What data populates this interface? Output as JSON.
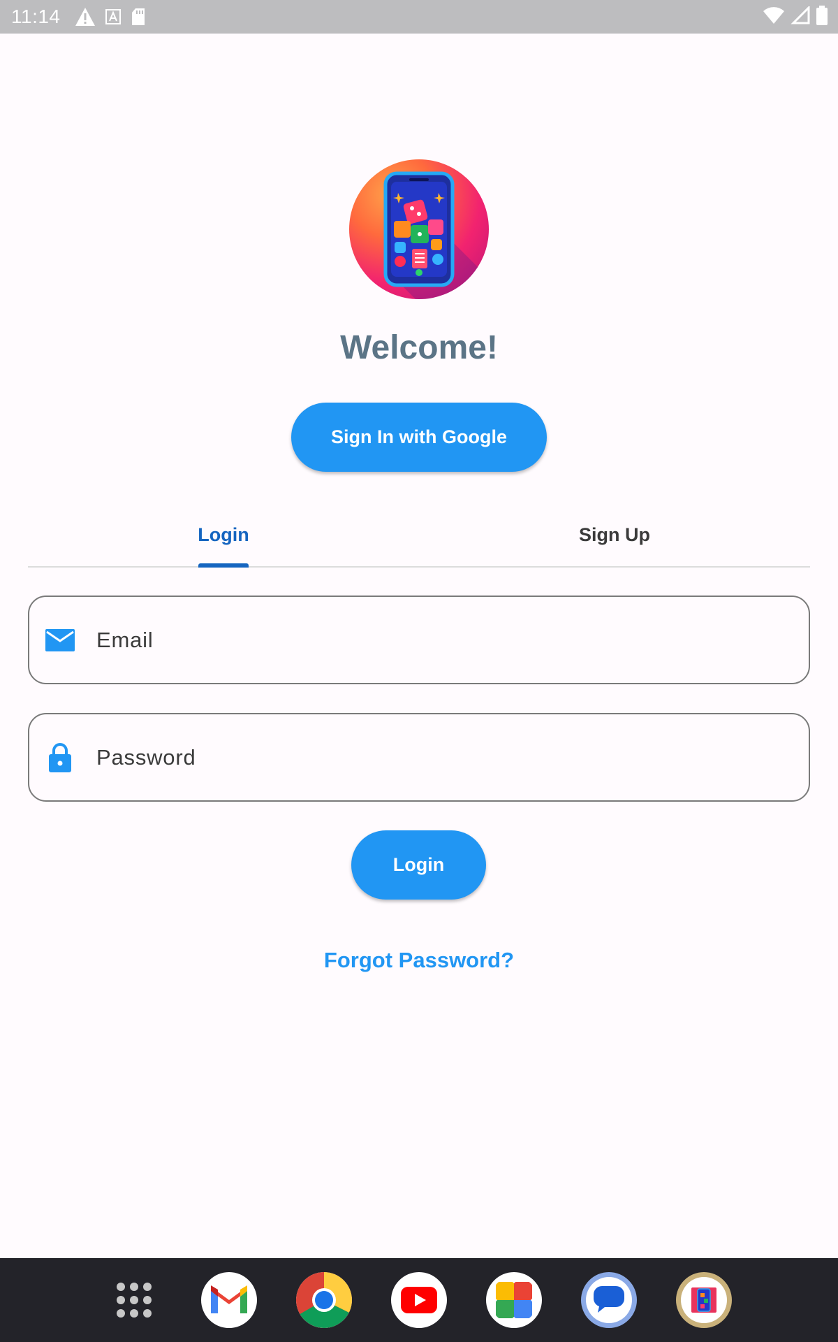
{
  "status_bar": {
    "time": "11:14",
    "left_icons": [
      "warning-icon",
      "font-icon",
      "sd-card-icon"
    ],
    "right_icons": [
      "wifi-icon",
      "signal-icon",
      "battery-icon"
    ]
  },
  "app": {
    "welcome_text": "Welcome!",
    "google_button_label": "Sign In with Google",
    "tabs": [
      {
        "label": "Login",
        "selected": true
      },
      {
        "label": "Sign Up",
        "selected": false
      }
    ],
    "email": {
      "placeholder": "Email",
      "value": "",
      "icon": "mail-icon"
    },
    "password": {
      "placeholder": "Password",
      "value": "",
      "icon": "lock-icon"
    },
    "login_button_label": "Login",
    "forgot_password_label": "Forgot Password?"
  },
  "dock": {
    "apps": [
      "app-drawer",
      "gmail",
      "chrome",
      "youtube",
      "photos",
      "messages",
      "dice-app"
    ]
  },
  "colors": {
    "primary": "#2196f3",
    "tab_selected": "#1565c0",
    "welcome": "#5b7486",
    "background": "#fffbfe",
    "dock": "#232329",
    "status_bar": "#bdbdbf"
  }
}
